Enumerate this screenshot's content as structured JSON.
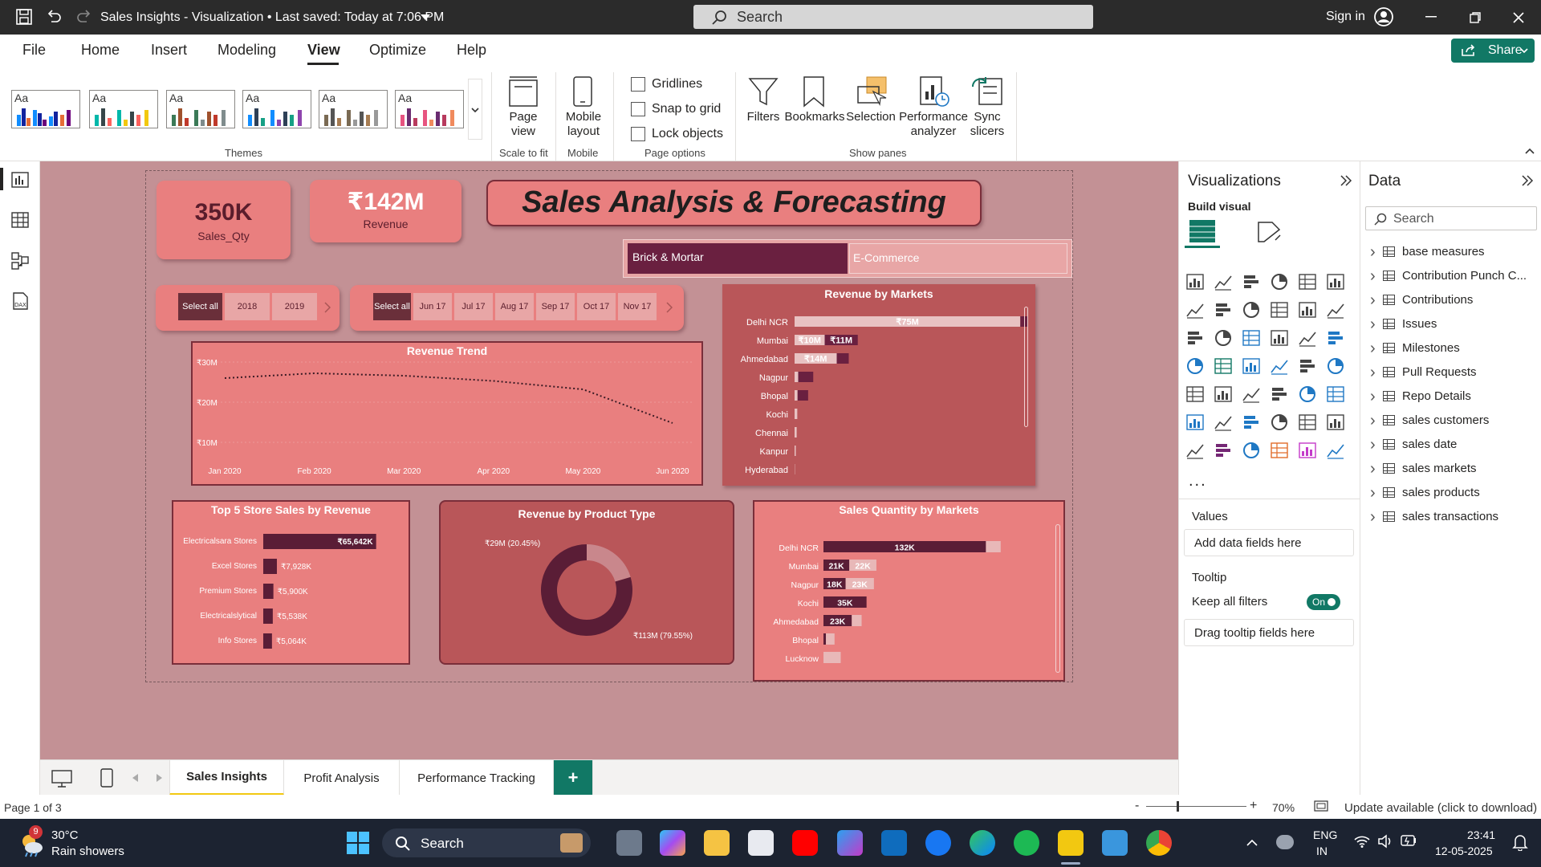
{
  "titlebar": {
    "title": "Sales Insights - Visualization • Last saved: Today at 7:06 PM",
    "search": "Search",
    "signin": "Sign in"
  },
  "menu": {
    "items": [
      "File",
      "Home",
      "Insert",
      "Modeling",
      "View",
      "Optimize",
      "Help"
    ],
    "active": "View",
    "share": "Share"
  },
  "ribbon": {
    "themes_label": "Themes",
    "theme_aa": "Aa",
    "page_view": "Page view",
    "scale_to_fit": "Scale to fit",
    "mobile_layout": "Mobile layout",
    "mobile": "Mobile",
    "gridlines": "Gridlines",
    "snap_to_grid": "Snap to grid",
    "lock_objects": "Lock objects",
    "page_options": "Page options",
    "filters": "Filters",
    "bookmarks": "Bookmarks",
    "selection": "Selection",
    "performance_analyzer": "Performance analyzer",
    "sync_slicers": "Sync slicers",
    "show_panes": "Show panes"
  },
  "report": {
    "kpi_qty_value": "350K",
    "kpi_qty_label": "Sales_Qty",
    "kpi_rev_value": "₹142M",
    "kpi_rev_label": "Revenue",
    "title": "Sales Analysis & Forecasting",
    "channel_options": [
      "Brick & Mortar",
      "E-Commerce"
    ],
    "year_slicer": [
      "Select all",
      "2018",
      "2019"
    ],
    "month_slicer": [
      "Select all",
      "Jun 17",
      "Jul 17",
      "Aug 17",
      "Sep 17",
      "Oct 17",
      "Nov 17"
    ]
  },
  "chart_data": [
    {
      "type": "line",
      "title": "Revenue Trend",
      "x": [
        "Jan 2020",
        "Feb 2020",
        "Mar 2020",
        "Apr 2020",
        "May 2020",
        "Jun 2020"
      ],
      "series": [
        {
          "values": [
            26.0,
            27.2,
            26.6,
            25.3,
            23.2,
            14.8
          ]
        }
      ],
      "yticks": [
        "₹30M",
        "₹20M",
        "₹10M"
      ],
      "ylim": [
        10,
        30
      ]
    },
    {
      "type": "bar",
      "title": "Revenue by Markets",
      "categories": [
        "Delhi NCR",
        "Mumbai",
        "Ahmedabad",
        "Nagpur",
        "Bhopal",
        "Kochi",
        "Chennai",
        "Kanpur",
        "Hyderabad"
      ],
      "series": [
        {
          "values": [
            75,
            10,
            14,
            1.2,
            1.0,
            0.9,
            0.7,
            0.4,
            0.1
          ]
        },
        {
          "values": [
            2.5,
            11,
            4,
            5,
            3.5,
            0,
            0,
            0,
            0
          ]
        }
      ],
      "labels": [
        [
          "₹75M",
          "₹10M",
          "₹14M",
          "",
          "",
          "",
          "",
          "",
          ""
        ],
        [
          "",
          "₹11M",
          "",
          "",
          "",
          "",
          "",
          "",
          ""
        ]
      ],
      "xlim": [
        0,
        80
      ]
    },
    {
      "type": "bar",
      "title": "Top 5 Store Sales by Revenue",
      "categories": [
        "Electricalsara Stores",
        "Excel Stores",
        "Premium Stores",
        "Electricalslytical",
        "Info Stores"
      ],
      "values": [
        65.642,
        7.928,
        5.9,
        5.538,
        5.064
      ],
      "labels": [
        "₹65,642K",
        "₹7,928K",
        "₹5,900K",
        "₹5,538K",
        "₹5,064K"
      ],
      "xlim": [
        0,
        70
      ]
    },
    {
      "type": "pie",
      "title": "Revenue by Product Type",
      "values": [
        29,
        113
      ],
      "labels": [
        "₹29M (20.45%)",
        "₹113M (79.55%)"
      ]
    },
    {
      "type": "bar",
      "title": "Sales Quantity by Markets",
      "categories": [
        "Delhi NCR",
        "Mumbai",
        "Nagpur",
        "Kochi",
        "Ahmedabad",
        "Bhopal",
        "Lucknow"
      ],
      "series": [
        {
          "values": [
            132,
            21,
            18,
            35,
            23,
            2,
            0
          ]
        },
        {
          "values": [
            12,
            22,
            23,
            0,
            8,
            7,
            14
          ]
        }
      ],
      "labels": [
        [
          "132K",
          "21K",
          "18K",
          "35K",
          "23K",
          "",
          ""
        ],
        [
          "",
          "22K",
          "23K",
          "",
          "",
          "",
          ""
        ]
      ],
      "xlim": [
        0,
        150
      ]
    }
  ],
  "pages": {
    "tabs": [
      "Sales Insights",
      "Profit Analysis",
      "Performance Tracking"
    ],
    "active": "Sales Insights",
    "add": "+"
  },
  "status": {
    "page": "Page 1 of 3",
    "zoom": "70%",
    "update": "Update available (click to download)",
    "zoom_minus": "-",
    "zoom_plus": "+"
  },
  "viz_pane": {
    "title": "Visualizations",
    "build": "Build visual",
    "values": "Values",
    "values_well": "Add data fields here",
    "tooltip": "Tooltip",
    "keep_filters": "Keep all filters",
    "toggle": "On",
    "tooltip_well": "Drag tooltip fields here",
    "more": "..."
  },
  "data_pane": {
    "title": "Data",
    "search": "Search",
    "fields": [
      "base measures",
      "Contribution Punch C...",
      "Contributions",
      "Issues",
      "Milestones",
      "Pull Requests",
      "Repo Details",
      "sales customers",
      "sales date",
      "sales markets",
      "sales products",
      "sales transactions"
    ]
  },
  "taskbar": {
    "temp": "30°C",
    "weather": "Rain showers",
    "badge": "9",
    "search": "Search",
    "lang1": "ENG",
    "lang2": "IN",
    "time": "23:41",
    "date": "12-05-2025"
  },
  "colors": {
    "canvas": "#c39195",
    "card": "#e97f7f",
    "dark": "#6a2f3a",
    "panel": "#b95659",
    "accent": "#117865"
  }
}
